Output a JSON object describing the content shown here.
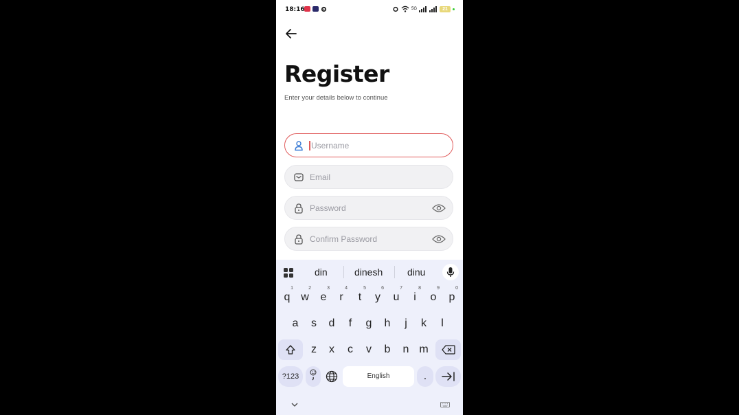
{
  "status_bar": {
    "time": "18:16",
    "battery": "21",
    "network": "5G"
  },
  "header": {
    "title": "Register",
    "subtitle": "Enter your details below to continue"
  },
  "form": {
    "username": {
      "placeholder": "Username"
    },
    "email": {
      "placeholder": "Email"
    },
    "password": {
      "placeholder": "Password"
    },
    "confirm_password": {
      "placeholder": "Confirm Password"
    }
  },
  "keyboard": {
    "suggestions": [
      "din",
      "dinesh",
      "dinu"
    ],
    "row1": [
      {
        "k": "q",
        "n": "1"
      },
      {
        "k": "w",
        "n": "2"
      },
      {
        "k": "e",
        "n": "3"
      },
      {
        "k": "r",
        "n": "4"
      },
      {
        "k": "t",
        "n": "5"
      },
      {
        "k": "y",
        "n": "6"
      },
      {
        "k": "u",
        "n": "7"
      },
      {
        "k": "i",
        "n": "8"
      },
      {
        "k": "o",
        "n": "9"
      },
      {
        "k": "p",
        "n": "0"
      }
    ],
    "row2": [
      "a",
      "s",
      "d",
      "f",
      "g",
      "h",
      "j",
      "k",
      "l"
    ],
    "row3": [
      "z",
      "x",
      "c",
      "v",
      "b",
      "n",
      "m"
    ],
    "symbols_label": "?123",
    "space_label": "English",
    "period_label": "."
  },
  "colors": {
    "accent": "#e05a5a",
    "keyboard_bg": "#eef0fb",
    "field_bg": "#f1f1f3"
  }
}
